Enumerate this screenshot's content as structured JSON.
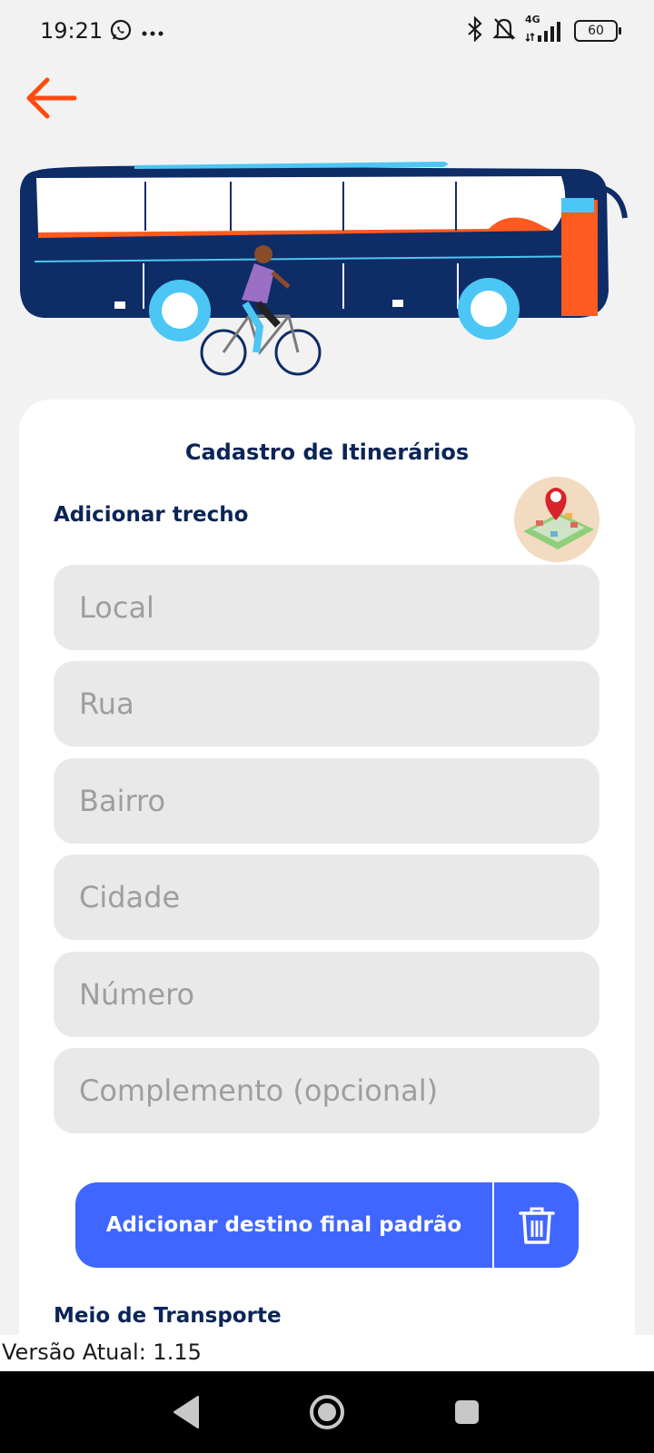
{
  "status_bar": {
    "time": "19:21",
    "battery": "60",
    "network": "4G"
  },
  "icons": {
    "back": "arrow-left-icon",
    "whatsapp": "whatsapp-icon",
    "more": "more-dots-icon",
    "bluetooth": "bluetooth-icon",
    "mute": "bell-off-icon",
    "signal": "signal-icon",
    "battery": "battery-icon",
    "map": "map-pin-icon",
    "trash": "trash-icon",
    "nav_back": "nav-back-icon",
    "nav_home": "nav-home-icon",
    "nav_recent": "nav-recent-icon"
  },
  "colors": {
    "accent": "#ff5a1f",
    "primary": "#3f66ff",
    "heading": "#0b2556",
    "field_bg": "#e9e9e9",
    "page_bg": "#f2f2f2"
  },
  "card": {
    "title": "Cadastro de Itinerários",
    "section": "Adicionar trecho",
    "fields": {
      "local": "Local",
      "rua": "Rua",
      "bairro": "Bairro",
      "cidade": "Cidade",
      "numero": "Número",
      "complemento": "Complemento (opcional)"
    },
    "add_destination_label": "Adicionar destino final padrão",
    "transport_section": "Meio de Transporte"
  },
  "footer": {
    "version": "Versão Atual: 1.15"
  }
}
